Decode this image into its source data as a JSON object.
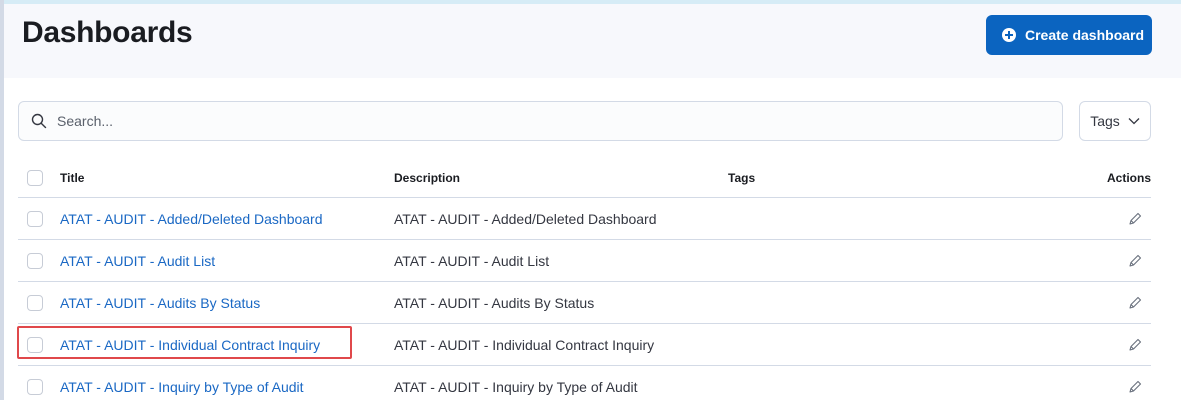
{
  "header": {
    "title": "Dashboards",
    "create_button_label": "Create dashboard"
  },
  "search": {
    "placeholder": "Search...",
    "tags_filter_label": "Tags"
  },
  "table": {
    "columns": {
      "title": "Title",
      "description": "Description",
      "tags": "Tags",
      "actions": "Actions"
    },
    "rows": [
      {
        "title": "ATAT - AUDIT - Added/Deleted Dashboard",
        "description": "ATAT - AUDIT - Added/Deleted Dashboard",
        "tags": ""
      },
      {
        "title": "ATAT - AUDIT - Audit List",
        "description": "ATAT - AUDIT - Audit List",
        "tags": ""
      },
      {
        "title": "ATAT - AUDIT - Audits By Status",
        "description": "ATAT - AUDIT - Audits By Status",
        "tags": ""
      },
      {
        "title": "ATAT - AUDIT - Individual Contract Inquiry",
        "description": "ATAT - AUDIT - Individual Contract Inquiry",
        "tags": ""
      },
      {
        "title": "ATAT - AUDIT - Inquiry by Type of Audit",
        "description": "ATAT - AUDIT - Inquiry by Type of Audit",
        "tags": ""
      }
    ]
  },
  "icons": {
    "create": "plus-circle-icon",
    "search": "search-icon",
    "tags_dropdown": "chevron-down-icon",
    "row_action": "pencil-icon"
  },
  "colors": {
    "accent": "#0b64c0",
    "link": "#1a68c4",
    "highlight_border": "#e0484b",
    "header_bg": "#f7f8fc"
  }
}
